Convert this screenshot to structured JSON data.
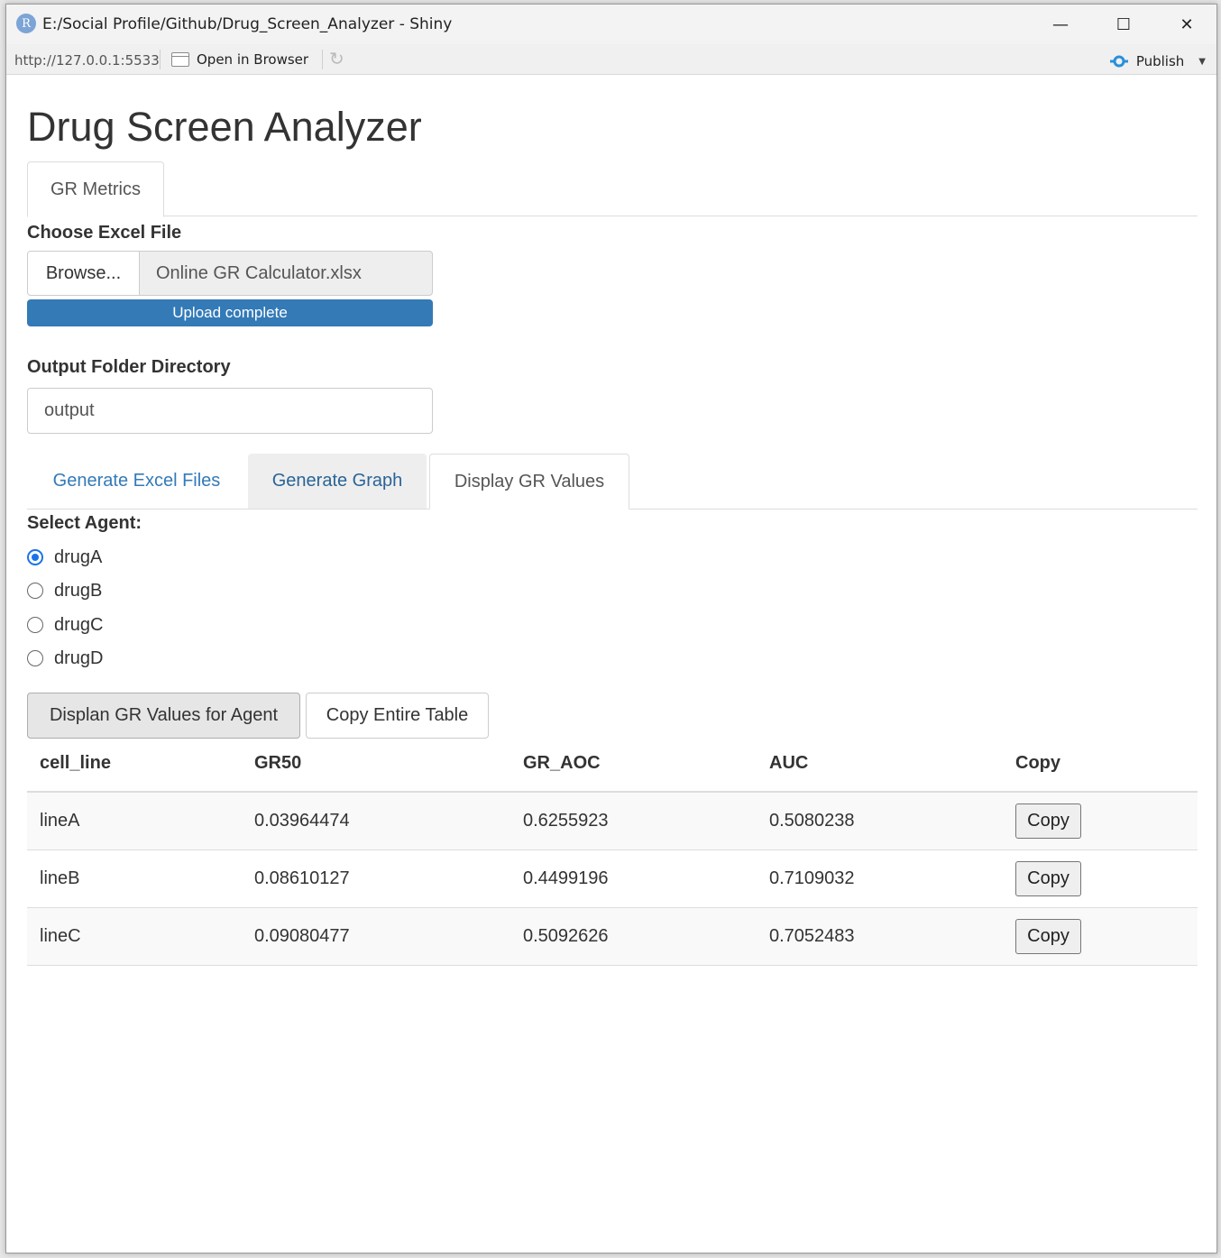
{
  "window": {
    "title": "E:/Social Profile/Github/Drug_Screen_Analyzer - Shiny",
    "minimize_glyph": "—",
    "maximize_glyph": "☐",
    "close_glyph": "✕"
  },
  "toolbar": {
    "url": "http://127.0.0.1:5533",
    "open_in_browser": "Open in Browser",
    "publish": "Publish"
  },
  "page": {
    "title": "Drug Screen Analyzer",
    "top_tabs": [
      {
        "label": "GR Metrics",
        "active": true
      }
    ],
    "file_input": {
      "label": "Choose Excel File",
      "browse_label": "Browse...",
      "file_name": "Online GR Calculator.xlsx",
      "progress_text": "Upload complete",
      "progress": 1.0
    },
    "output_dir": {
      "label": "Output Folder Directory",
      "value": "output"
    },
    "sub_tabs": [
      {
        "label": "Generate Excel Files",
        "state": "link"
      },
      {
        "label": "Generate Graph",
        "state": "hover"
      },
      {
        "label": "Display GR Values",
        "state": "active"
      }
    ],
    "agent": {
      "label": "Select Agent:",
      "options": [
        "drugA",
        "drugB",
        "drugC",
        "drugD"
      ],
      "selected": "drugA"
    },
    "buttons": {
      "display": "Displan GR Values for Agent",
      "copy_table": "Copy Entire Table"
    },
    "table": {
      "headers": [
        "cell_line",
        "GR50",
        "GR_AOC",
        "AUC",
        "Copy"
      ],
      "rows": [
        [
          "lineA",
          "0.03964474",
          "0.6255923",
          "0.5080238",
          "Copy"
        ],
        [
          "lineB",
          "0.08610127",
          "0.4499196",
          "0.7109032",
          "Copy"
        ],
        [
          "lineC",
          "0.09080477",
          "0.5092626",
          "0.7052483",
          "Copy"
        ]
      ]
    }
  }
}
